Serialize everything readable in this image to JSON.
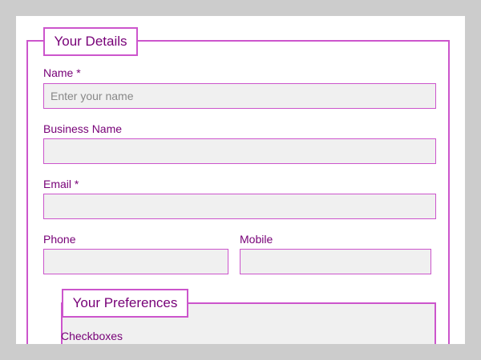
{
  "form": {
    "details_legend": "Your Details",
    "fields": {
      "name": {
        "label": "Name *",
        "value": "",
        "placeholder": "Enter your name"
      },
      "business_name": {
        "label": "Business Name",
        "value": "",
        "placeholder": ""
      },
      "email": {
        "label": "Email *",
        "value": "",
        "placeholder": ""
      },
      "phone": {
        "label": "Phone",
        "value": "",
        "placeholder": ""
      },
      "mobile": {
        "label": "Mobile",
        "value": "",
        "placeholder": ""
      }
    },
    "preferences_legend": "Your Preferences",
    "preferences_subheading": "Checkboxes"
  },
  "colors": {
    "page_bg": "#cccccc",
    "form_bg": "#ffffff",
    "accent_border": "#cc55cc",
    "text": "#770077",
    "input_bg": "#f0f0f0"
  }
}
